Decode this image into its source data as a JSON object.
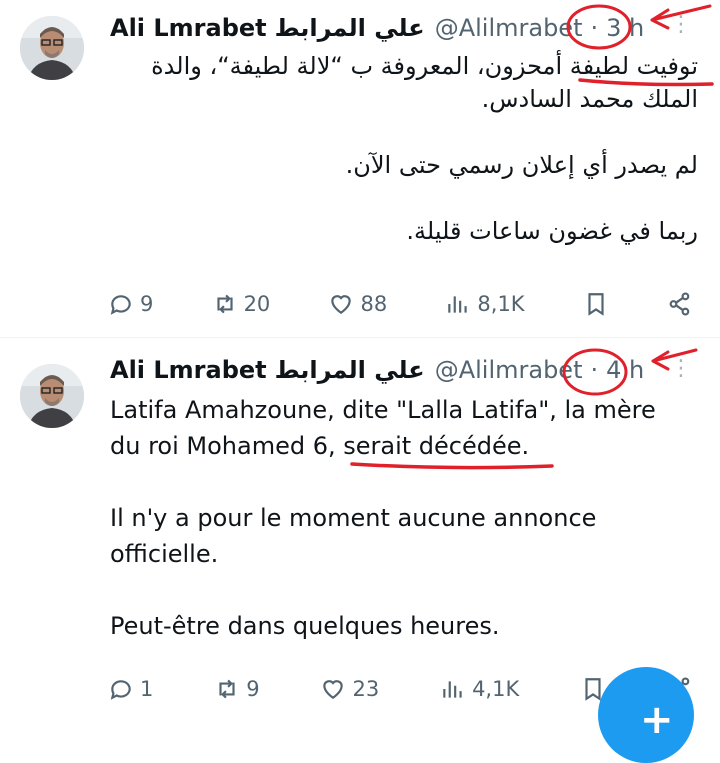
{
  "tweets": [
    {
      "author_name": "Ali Lmrabet",
      "author_name_ar": "علي المرابط",
      "handle": "@Alilmrabet",
      "separator": "·",
      "time": "3 h",
      "paragraphs": [
        "توفيت لطيفة أمحزون، المعروفة ب “لالة لطيفة“، والدة الملك محمد السادس.",
        "لم يصدر أي إعلان رسمي حتى الآن.",
        "ربما في غضون ساعات قليلة."
      ],
      "stats": {
        "replies": "9",
        "reposts": "20",
        "likes": "88",
        "views": "8,1K"
      }
    },
    {
      "author_name": "Ali Lmrabet",
      "author_name_ar": "علي المرابط",
      "handle": "@Alilmrabet",
      "separator": "·",
      "time": "4 h",
      "paragraphs": {
        "p1_part1": "Latifa Amahzoune, dite \"Lalla Latifa\", la mère du roi Mohamed 6, ",
        "p1_highlight": "serait décédée.",
        "p2": "Il n'y a pour le moment aucune annonce officielle.",
        "p3": "Peut-être dans quelques heures."
      },
      "stats": {
        "replies": "1",
        "reposts": "9",
        "likes": "23",
        "views": "4,1K"
      }
    }
  ],
  "icons": {
    "reply": "reply-icon",
    "repost": "repost-icon",
    "like": "heart-icon",
    "views": "views-icon",
    "bookmark": "bookmark-icon",
    "share": "share-icon",
    "more": "more-icon",
    "compose": "compose-icon"
  },
  "colors": {
    "text": "#0f1419",
    "secondary": "#536471",
    "annotation_red": "#e0202a",
    "fab_blue": "#1d9bf0"
  }
}
